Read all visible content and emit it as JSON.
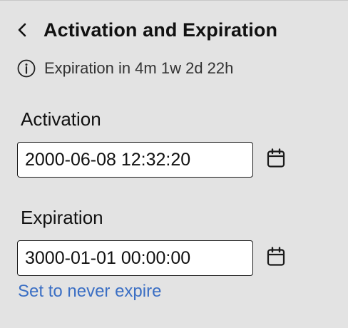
{
  "header": {
    "back_icon": "chevron-left-icon",
    "title": "Activation and Expiration"
  },
  "info": {
    "icon": "info-circle-icon",
    "text": "Expiration in 4m 1w 2d 22h"
  },
  "activation": {
    "label": "Activation",
    "value": "2000-06-08 12:32:20",
    "calendar_icon": "calendar-icon"
  },
  "expiration": {
    "label": "Expiration",
    "value": "3000-01-01 00:00:00",
    "calendar_icon": "calendar-icon"
  },
  "never_expire_link": "Set to never expire",
  "colors": {
    "background": "#e3e3e3",
    "link": "#3b6fc4",
    "input_border": "#1a1a1a"
  }
}
